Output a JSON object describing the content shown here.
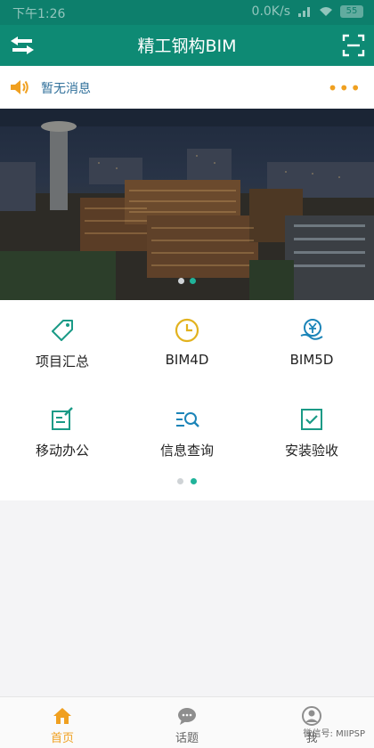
{
  "status": {
    "time": "下午1:26",
    "speed": "0.0K/s",
    "battery": "55"
  },
  "header": {
    "title": "精工钢构BIM"
  },
  "notice": {
    "text": "暂无消息",
    "more": "•••"
  },
  "menu": [
    {
      "label": "项目汇总",
      "icon": "tag-icon"
    },
    {
      "label": "BIM4D",
      "icon": "clock-icon"
    },
    {
      "label": "BIM5D",
      "icon": "money-icon"
    },
    {
      "label": "移动办公",
      "icon": "edit-note-icon"
    },
    {
      "label": "信息查询",
      "icon": "search-list-icon"
    },
    {
      "label": "安装验收",
      "icon": "check-box-icon"
    }
  ],
  "tabs": [
    {
      "label": "首页",
      "icon": "home-icon",
      "active": true
    },
    {
      "label": "话题",
      "icon": "chat-icon",
      "active": false
    },
    {
      "label": "我",
      "icon": "person-icon",
      "active": false
    }
  ],
  "watermark": "微信号: MIIPSP",
  "colors": {
    "primary": "#0e8a74",
    "accent": "#f0a020",
    "icon_teal": "#1a9a86",
    "icon_gold": "#e2b21e",
    "icon_blue": "#1b84b8"
  }
}
